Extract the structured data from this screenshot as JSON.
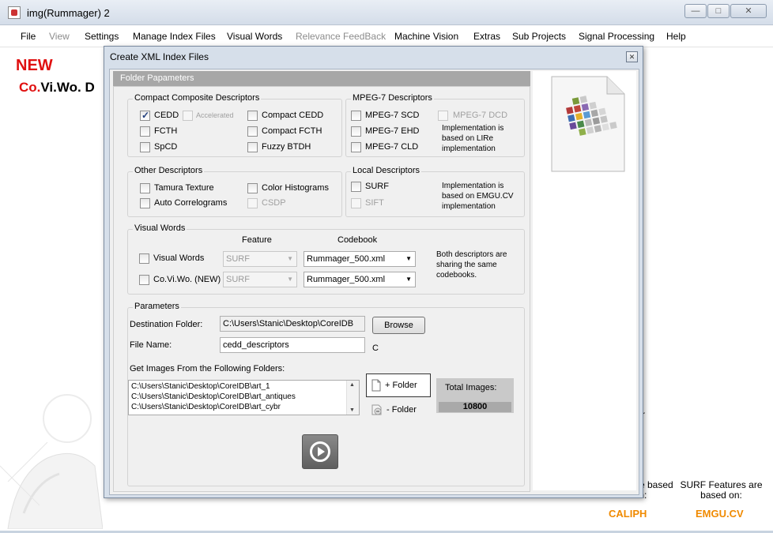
{
  "window": {
    "title": "img(Rummager) 2",
    "min_glyph": "—",
    "max_glyph": "□",
    "close_glyph": "✕"
  },
  "menu": {
    "file": "File",
    "view": "View",
    "settings": "Settings",
    "manage": "Manage Index Files",
    "visual_words": "Visual Words",
    "relevance": "Relevance FeedBack",
    "machine_vision": "Machine Vision",
    "extras": "Extras",
    "sub_projects": "Sub Projects",
    "signal_processing": "Signal Processing",
    "help": "Help"
  },
  "background": {
    "new_label": "NEW",
    "covivo_red": "Co.",
    "covivo_rest": "Vi.Wo. D",
    "r_fragment": "r",
    "caliph_caption": "tures are based on:",
    "emgu_caption": "SURF Features are based on:",
    "caliph_link": "CALIPH",
    "emgu_link": "EMGU.CV"
  },
  "dialog": {
    "title": "Create XML Index Files",
    "close_glyph": "✕",
    "panel_header": "Folder Papameters",
    "compact": {
      "title": "Compact Composite Descriptors",
      "cedd": "CEDD",
      "accelerated": "Accelerated",
      "fcth": "FCTH",
      "spcd": "SpCD",
      "compact_cedd": "Compact CEDD",
      "compact_fcth": "Compact FCTH",
      "fuzzy_btdh": "Fuzzy BTDH",
      "cedd_checked": true
    },
    "mpeg7": {
      "title": "MPEG-7 Descriptors",
      "scd": "MPEG-7 SCD",
      "ehd": "MPEG-7 EHD",
      "cld": "MPEG-7 CLD",
      "dcd": "MPEG-7 DCD",
      "note": "Implementation is based on LIRe implementation"
    },
    "other": {
      "title": "Other Descriptors",
      "tamura": "Tamura Texture",
      "auto_corr": "Auto Correlograms",
      "color_hist": "Color Histograms",
      "csdp": "CSDP"
    },
    "local": {
      "title": "Local Descriptors",
      "surf": "SURF",
      "sift": "SIFT",
      "note": "Implementation is based on EMGU.CV implementation"
    },
    "visual_words": {
      "title": "Visual Words",
      "feature_header": "Feature",
      "codebook_header": "Codebook",
      "row1_label": "Visual Words",
      "row1_feature": "SURF",
      "row1_codebook": "Rummager_500.xml",
      "row2_label": "Co.Vi.Wo. (NEW)",
      "row2_feature": "SURF",
      "row2_codebook": "Rummager_500.xml",
      "note": "Both descriptors are sharing the same codebooks."
    },
    "parameters": {
      "title": "Parameters",
      "dest_label": "Destination Folder:",
      "dest_value": "C:\\Users\\Stanic\\Desktop\\CoreIDB",
      "browse": "Browse",
      "file_label": "File Name:",
      "file_value": "cedd_descriptors",
      "file_suffix": "C",
      "images_label": "Get Images From the Following Folders:",
      "folders": [
        "C:\\Users\\Stanic\\Desktop\\CoreIDB\\art_1",
        "C:\\Users\\Stanic\\Desktop\\CoreIDB\\art_antiques",
        "C:\\Users\\Stanic\\Desktop\\CoreIDB\\art_cybr"
      ],
      "add_folder": "+ Folder",
      "remove_folder": "- Folder",
      "total_label": "Total Images:",
      "total_value": "10800"
    }
  }
}
